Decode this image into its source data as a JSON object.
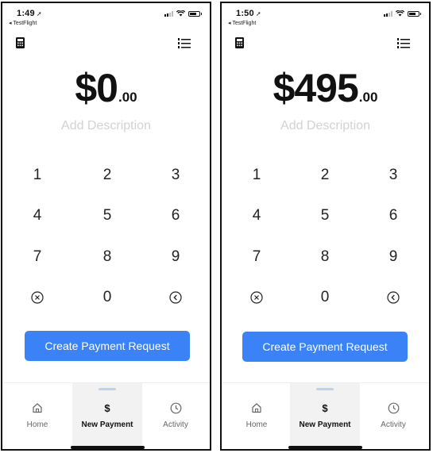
{
  "screens": [
    {
      "status": {
        "time": "1:49",
        "back_label": "◂ TestFlight"
      },
      "amount": {
        "dollars": "$0",
        "cents": ".00"
      },
      "description_placeholder": "Add Description",
      "keys": [
        "1",
        "2",
        "3",
        "4",
        "5",
        "6",
        "7",
        "8",
        "9",
        "0"
      ],
      "cta_label": "Create Payment Request",
      "tabs": [
        {
          "label": "Home",
          "icon": "home-icon"
        },
        {
          "label": "New Payment",
          "icon": "dollar-icon",
          "glyph": "$",
          "active": true
        },
        {
          "label": "Activity",
          "icon": "clock-icon"
        }
      ]
    },
    {
      "status": {
        "time": "1:50",
        "back_label": "◂ TestFlight"
      },
      "amount": {
        "dollars": "$495",
        "cents": ".00"
      },
      "description_placeholder": "Add Description",
      "keys": [
        "1",
        "2",
        "3",
        "4",
        "5",
        "6",
        "7",
        "8",
        "9",
        "0"
      ],
      "cta_label": "Create Payment Request",
      "tabs": [
        {
          "label": "Home",
          "icon": "home-icon"
        },
        {
          "label": "New Payment",
          "icon": "dollar-icon",
          "glyph": "$",
          "active": true
        },
        {
          "label": "Activity",
          "icon": "clock-icon"
        }
      ]
    }
  ],
  "colors": {
    "accent": "#3b82f6",
    "placeholder": "#d2d2d2",
    "active_tab_bg": "#f2f2f2"
  }
}
